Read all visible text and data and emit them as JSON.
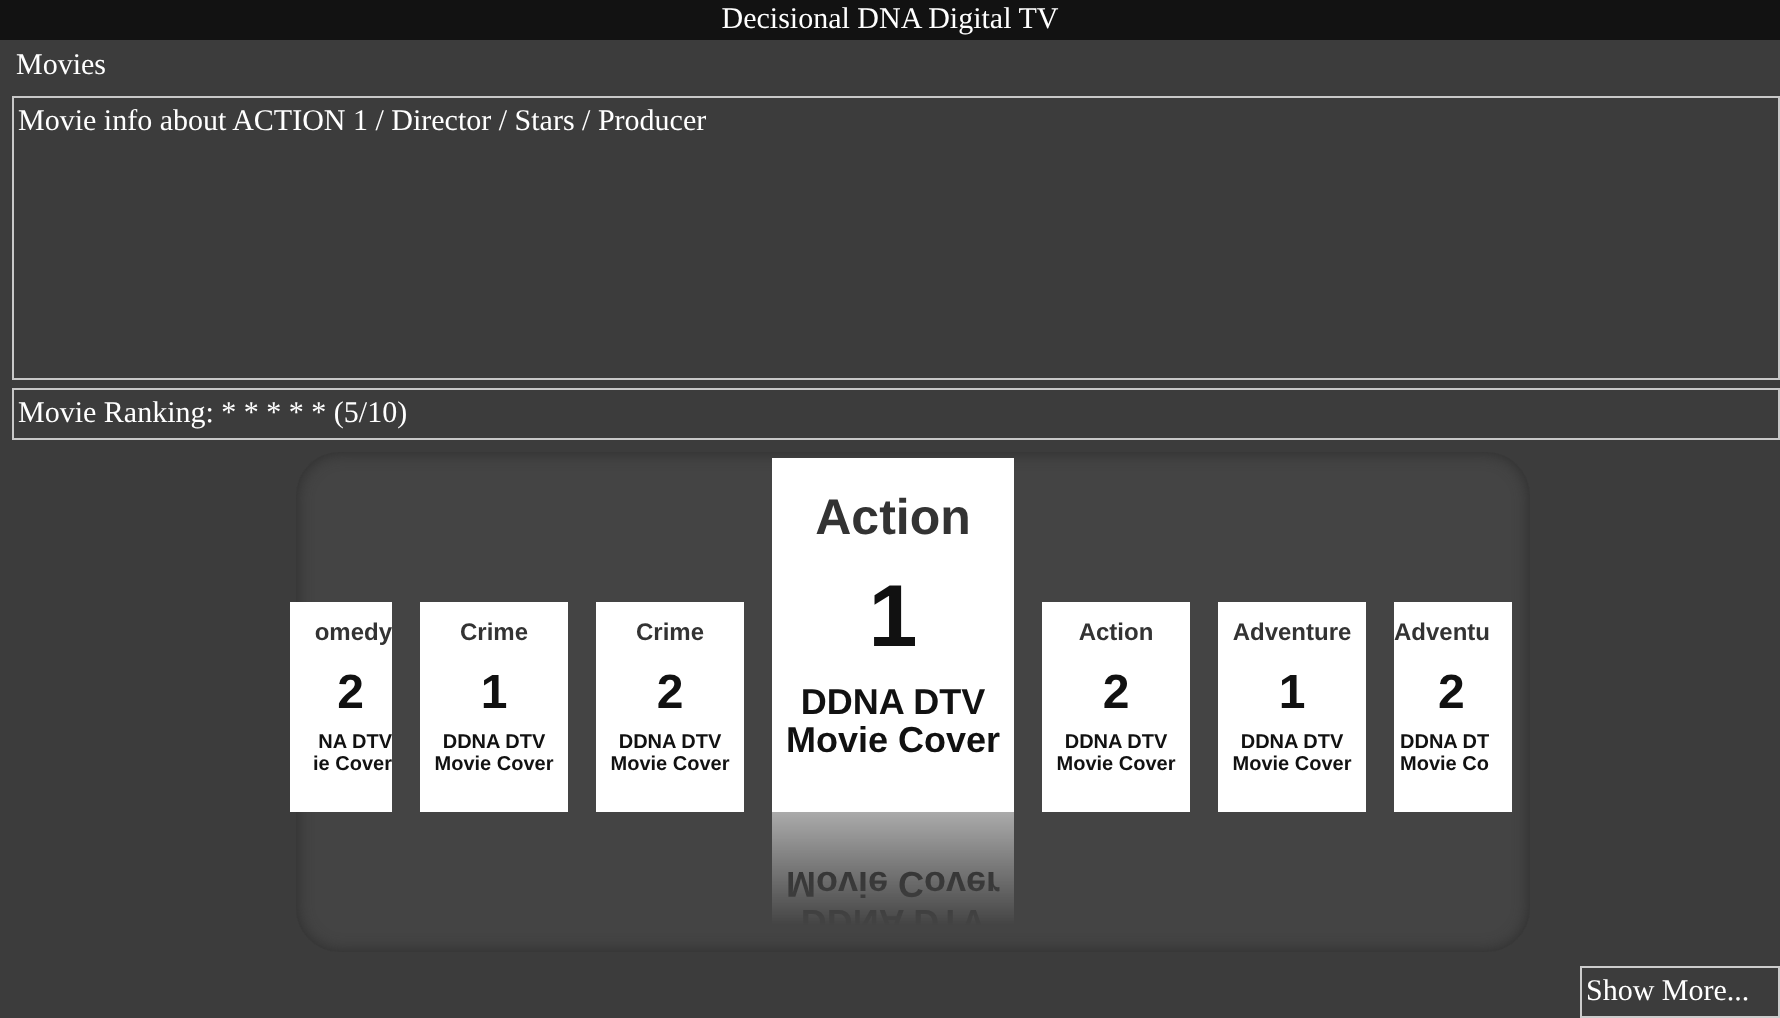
{
  "window": {
    "title": "Decisional DNA Digital TV"
  },
  "section": "Movies",
  "info": "Movie info about ACTION 1 / Director / Stars / Producer",
  "ranking": "Movie Ranking: * * * * * (5/10)",
  "carousel": [
    {
      "kind": "cut-left",
      "selected": false,
      "genre": "omedy",
      "number": "2",
      "line1": "NA DTV",
      "line2": "ie Cover"
    },
    {
      "kind": "full",
      "selected": false,
      "genre": "Crime",
      "number": "1",
      "line1": "DDNA DTV",
      "line2": "Movie Cover"
    },
    {
      "kind": "full",
      "selected": false,
      "genre": "Crime",
      "number": "2",
      "line1": "DDNA DTV",
      "line2": "Movie Cover"
    },
    {
      "kind": "full",
      "selected": true,
      "genre": "Action",
      "number": "1",
      "line1": "DDNA DTV",
      "line2": "Movie Cover"
    },
    {
      "kind": "full",
      "selected": false,
      "genre": "Action",
      "number": "2",
      "line1": "DDNA DTV",
      "line2": "Movie Cover"
    },
    {
      "kind": "full",
      "selected": false,
      "genre": "Adventure",
      "number": "1",
      "line1": "DDNA DTV",
      "line2": "Movie Cover"
    },
    {
      "kind": "cut-right",
      "selected": false,
      "genre": "Adventu",
      "number": "2",
      "line1": "DDNA DT",
      "line2": "Movie Co"
    }
  ],
  "show_more": "Show More..."
}
